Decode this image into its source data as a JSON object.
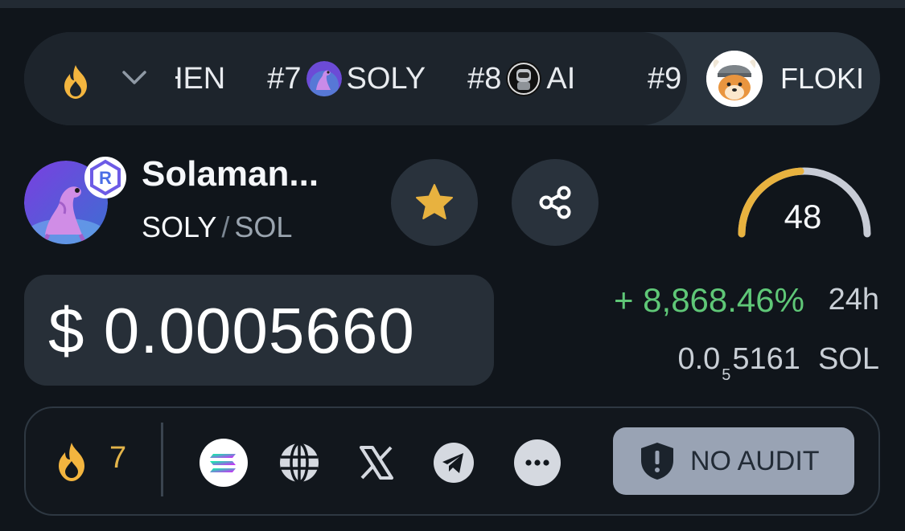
{
  "trending": {
    "partial_left": "HEN",
    "items": [
      {
        "rank": "#7",
        "symbol": "SOLY"
      },
      {
        "rank": "#8",
        "symbol": "AI"
      }
    ],
    "partial_rank": "#9",
    "featured": {
      "symbol": "FLOKI"
    }
  },
  "token": {
    "name": "Solaman...",
    "symbol": "SOLY",
    "separator": "/",
    "quote": "SOL",
    "score": "48",
    "score_value": 48,
    "score_max": 100
  },
  "price": {
    "usd": "$ 0.0005660",
    "change": "+ 8,868.46%",
    "change_period": "24h",
    "sol_lead": "0.0",
    "sol_zero_count": "5",
    "sol_digits": "5161",
    "sol_unit": "SOL"
  },
  "stats": {
    "fire_count": "7"
  },
  "audit": {
    "label": "NO AUDIT"
  },
  "icons": {
    "trend": "fire-icon",
    "expand": "chevron-down-icon",
    "favorite": "star-icon",
    "share": "share-icon",
    "socials": [
      "solana-icon",
      "globe-icon",
      "x-icon",
      "telegram-icon",
      "more-icon"
    ],
    "audit": "shield-alert-icon"
  },
  "colors": {
    "background": "#10151b",
    "positive": "#5fc777",
    "accent_gold": "#e8b23f",
    "audit_badge": "#99a3b4"
  }
}
